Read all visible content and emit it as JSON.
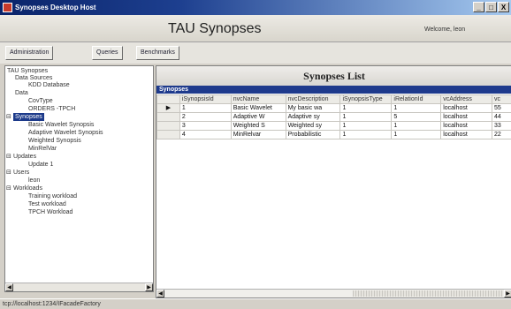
{
  "window": {
    "title": "Synopses Desktop Host",
    "minimize_glyph": "_",
    "restore_glyph": "□",
    "close_glyph": "X"
  },
  "header": {
    "app_title": "TAU Synopses",
    "welcome": "Welcome, leon"
  },
  "menu": {
    "administration": "Administration",
    "queries": "Queries",
    "benchmarks": "Benchmarks"
  },
  "tree": {
    "root": "TAU Synopses",
    "data_sources": "Data Sources",
    "kdd_database": "KDD Database",
    "data": "Data",
    "covtype": "CovType",
    "orders_tpch": "ORDERS -TPCH",
    "synopses": "Synopses",
    "basic_wavelet": "Basic Wavelet Synopsis",
    "adaptive_wavelet": "Adaptive Wavelet Synopsis",
    "weighted_synopsis": "Weighted Synopsis",
    "minrelvar": "MinRelVar",
    "updates": "Updates",
    "update_1": "Update 1",
    "users": "Users",
    "leon": "leon",
    "workloads": "Workloads",
    "training_workload": "Training workload",
    "test_workload": "Test workload",
    "tpch_workload": "TPCH Workload"
  },
  "list": {
    "title": "Synopses List",
    "caption": "Synopses",
    "columns": [
      "iSynopsisId",
      "nvcName",
      "nvcDescription",
      "iSynopsisType",
      "iRelationId",
      "vcAddress",
      "vc"
    ],
    "rows": [
      [
        "1",
        "Basic Wavelet",
        "My basic wa",
        "1",
        "1",
        "localhost",
        "55"
      ],
      [
        "2",
        "Adaptive W",
        "Adaptive sy",
        "1",
        "5",
        "localhost",
        "44"
      ],
      [
        "3",
        "Weighted S",
        "Weighted sy",
        "1",
        "1",
        "localhost",
        "33"
      ],
      [
        "4",
        "MinRelvar",
        "Probabilistic",
        "1",
        "1",
        "localhost",
        "22"
      ]
    ],
    "current_row_marker": "▶"
  },
  "status": {
    "text": "tcp://localhost:1234/IFacadeFactory"
  }
}
